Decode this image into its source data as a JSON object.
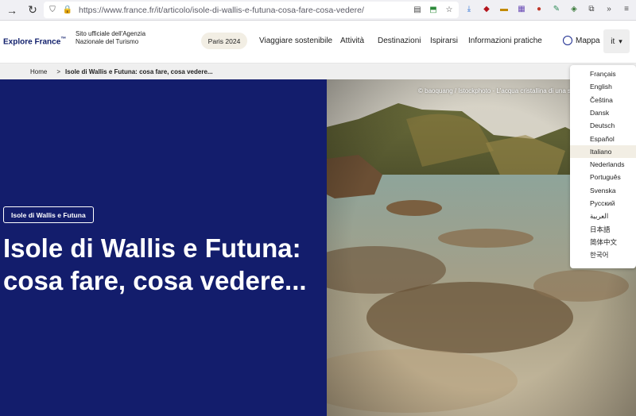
{
  "browser": {
    "url": "https://www.france.fr/it/articolo/isole-di-wallis-e-futuna-cosa-fare-cosa-vedere/"
  },
  "header": {
    "logo_text": "Explore France",
    "tm": "™",
    "tagline": "Sito ufficiale dell'Agenzia Nazionale del Turismo",
    "paris_pill": "Paris 2024",
    "menu": [
      "Viaggiare sostenibile",
      "Attività",
      "Destinazioni",
      "Ispirarsi",
      "Informazioni pratiche"
    ],
    "map_label": "Mappa",
    "lang_label": "it",
    "lang_caret": "▾"
  },
  "breadcrumb": {
    "home": "Home",
    "sep": ">",
    "current": "Isole di Wallis e Futuna: cosa fare, cosa vedere..."
  },
  "hero": {
    "tag": "Isole di Wallis e Futuna",
    "title": "Isole di Wallis e Futuna: cosa fare, cosa vedere...",
    "credit": "© baoquang / Istockphoto - L'acqua cristallina di una sp"
  },
  "languages": [
    "Français",
    "English",
    "Čeština",
    "Dansk",
    "Deutsch",
    "Español",
    "Italiano",
    "Nederlands",
    "Português",
    "Svenska",
    "Русский",
    "العربية",
    "日本語",
    "简体中文",
    "한국어"
  ],
  "selected_language": "Italiano",
  "colors": {
    "brand_navy": "#131d6c",
    "brand_red": "#e1000f",
    "pill_beige": "#f2eee4"
  }
}
